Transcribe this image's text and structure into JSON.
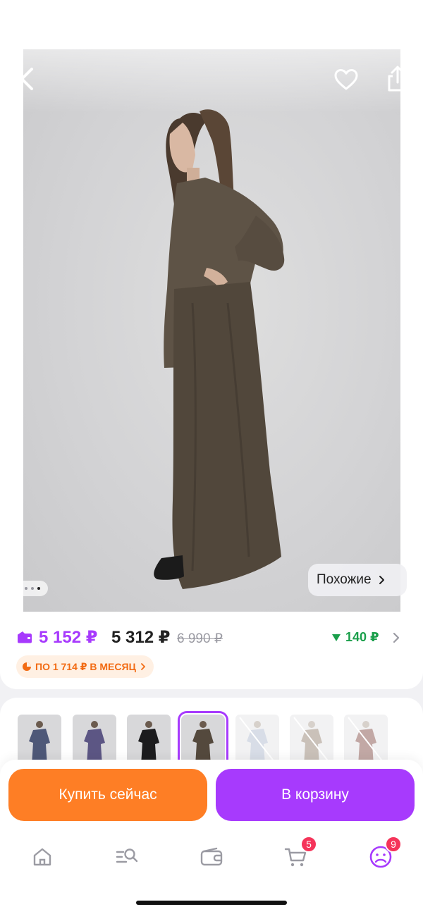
{
  "header": {
    "back_icon": "chevron-left-icon",
    "favorite_icon": "heart-icon",
    "share_icon": "share-icon"
  },
  "gallery": {
    "image": "product-photo-woman-in-brown-shirt-and-maxi-skirt",
    "pagination_total_dots": 3,
    "pagination_active_dot": 3,
    "similar_label": "Похожие"
  },
  "price": {
    "wallet_price": "5 152 ₽",
    "price": "5 312 ₽",
    "old_price": "6 990 ₽",
    "discount_value": "140 ₽",
    "installment": "ПО 1 714 ₽ В МЕСЯЦ",
    "accent_color": "#a73afd",
    "discount_color": "#1a9f4b",
    "installment_color": "#f26b14"
  },
  "variants": [
    {
      "color_name": "blue",
      "selected": false,
      "available": true
    },
    {
      "color_name": "violet",
      "selected": false,
      "available": true
    },
    {
      "color_name": "black",
      "selected": false,
      "available": true
    },
    {
      "color_name": "brown",
      "selected": true,
      "available": true
    },
    {
      "color_name": "light-blue",
      "selected": false,
      "available": false
    },
    {
      "color_name": "beige",
      "selected": false,
      "available": false
    },
    {
      "color_name": "burgundy",
      "selected": false,
      "available": false
    }
  ],
  "actions": {
    "buy_now_label": "Купить сейчас",
    "add_to_cart_label": "В корзину",
    "buy_color": "#fe7e25",
    "cart_color": "#a73afd"
  },
  "tabbar": {
    "items": [
      {
        "icon": "home-icon"
      },
      {
        "icon": "catalog-search-icon"
      },
      {
        "icon": "wallet-icon"
      },
      {
        "icon": "cart-icon",
        "badge": "5"
      },
      {
        "icon": "profile-icon",
        "badge": "9"
      }
    ]
  }
}
